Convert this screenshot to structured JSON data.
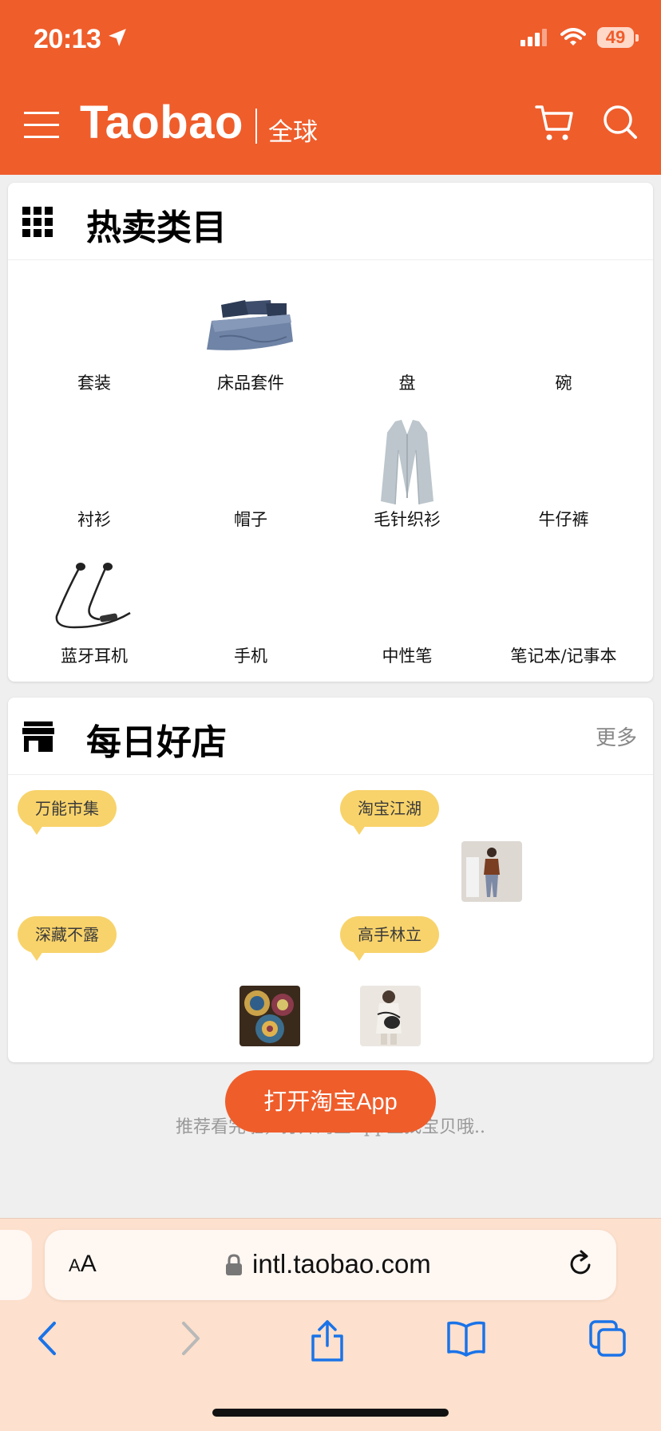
{
  "status_bar": {
    "time": "20:13",
    "battery": "49"
  },
  "header": {
    "logo": "Taobao",
    "logo_sub": "全球"
  },
  "hot_categories": {
    "title": "热卖类目",
    "items": [
      {
        "label": "套装"
      },
      {
        "label": "床品套件",
        "image": "bedding"
      },
      {
        "label": "盘"
      },
      {
        "label": "碗"
      },
      {
        "label": "衬衫"
      },
      {
        "label": "帽子"
      },
      {
        "label": "毛针织衫",
        "image": "cardigan"
      },
      {
        "label": "牛仔裤"
      },
      {
        "label": "蓝牙耳机",
        "image": "earphones"
      },
      {
        "label": "手机"
      },
      {
        "label": "中性笔"
      },
      {
        "label": "笔记本/记事本"
      }
    ]
  },
  "daily_shops": {
    "title": "每日好店",
    "more": "更多",
    "shops": [
      {
        "name": "万能市集"
      },
      {
        "name": "淘宝江湖"
      },
      {
        "name": "深藏不露"
      },
      {
        "name": "高手林立"
      }
    ]
  },
  "open_app_button": "打开淘宝App",
  "recommend_text": "推荐看完啦，打开淘宝App查找宝贝哦..",
  "browser": {
    "text_size_label": "AA",
    "url": "intl.taobao.com"
  },
  "colors": {
    "brand": "#ef5d2b",
    "tag": "#f8d36b",
    "browser_bg": "#fde0cd"
  }
}
